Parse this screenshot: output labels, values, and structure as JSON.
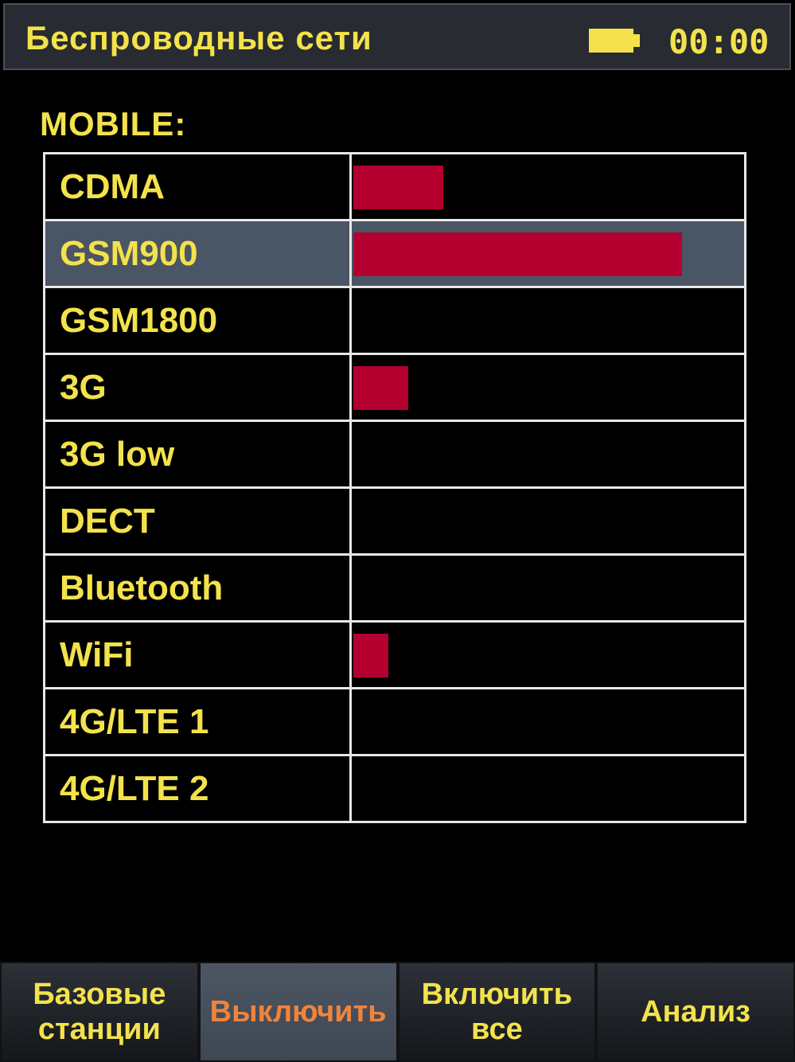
{
  "header": {
    "title": "Беспроводные сети",
    "clock": "00:00",
    "battery_icon": "battery-icon"
  },
  "section": {
    "label": "MOBILE:"
  },
  "bands": [
    {
      "name": "CDMA",
      "level": 0.23,
      "selected": false
    },
    {
      "name": "GSM900",
      "level": 0.84,
      "selected": true
    },
    {
      "name": "GSM1800",
      "level": 0,
      "selected": false
    },
    {
      "name": "3G",
      "level": 0.14,
      "selected": false
    },
    {
      "name": "3G low",
      "level": 0,
      "selected": false
    },
    {
      "name": "DECT",
      "level": 0,
      "selected": false
    },
    {
      "name": "Bluetooth",
      "level": 0,
      "selected": false
    },
    {
      "name": "WiFi",
      "level": 0.09,
      "selected": false
    },
    {
      "name": "4G/LTE 1",
      "level": 0,
      "selected": false
    },
    {
      "name": "4G/LTE 2",
      "level": 0,
      "selected": false
    }
  ],
  "toolbar": {
    "base_stations": "Базовые\nстанции",
    "turn_off": "Выключить",
    "turn_on_all": "Включить\nвсе",
    "analysis": "Анализ"
  },
  "colors": {
    "accent_text": "#f3e24b",
    "bar": "#b3002f",
    "selected_row": "#4a5566",
    "active_button_text": "#f0843a"
  }
}
